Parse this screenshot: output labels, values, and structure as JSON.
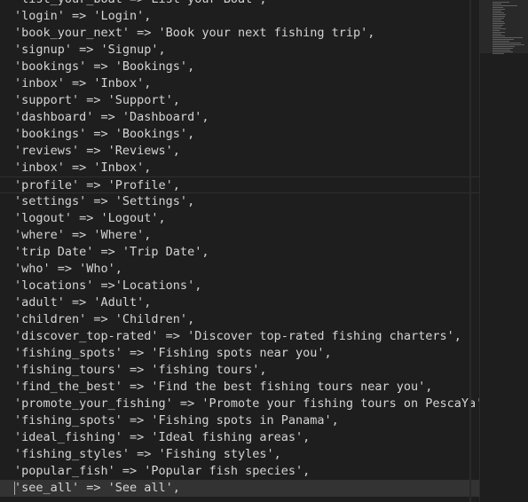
{
  "editor": {
    "lines": [
      "'list_your_boat'=>'List your Boat',",
      "'login' => 'Login',",
      "'book_your_next' => 'Book your next fishing trip',",
      "'signup' => 'Signup',",
      "'bookings' => 'Bookings',",
      "'inbox' => 'Inbox',",
      "'support' => 'Support',",
      "'dashboard' => 'Dashboard',",
      "'bookings' => 'Bookings',",
      "'reviews' => 'Reviews',",
      "'inbox' => 'Inbox',",
      "'profile' => 'Profile',",
      "'settings' => 'Settings',",
      "'logout' => 'Logout',",
      "'where' => 'Where',",
      "'trip Date' => 'Trip Date',",
      "'who' => 'Who',",
      "'locations' =>'Locations',",
      "'adult' => 'Adult',",
      "'children' => 'Children',",
      "'discover_top-rated' => 'Discover top-rated fishing charters',",
      "'fishing_spots' => 'Fishing spots near you',",
      "'fishing_tours' => 'fishing tours',",
      "'find_the_best' => 'Find the best fishing tours near you',",
      "'promote_your_fishing' => 'Promote your fishing tours on PescaYa',",
      "'fishing_spots' => 'Fishing spots in Panama',",
      "'ideal_fishing' => 'Ideal fishing areas',",
      "'fishing_styles' => 'Fishing styles',",
      "'popular_fish' => 'Popular fish species',",
      "'see_all' => 'See all',"
    ],
    "highlighted_line": 11,
    "current_line": 29
  }
}
